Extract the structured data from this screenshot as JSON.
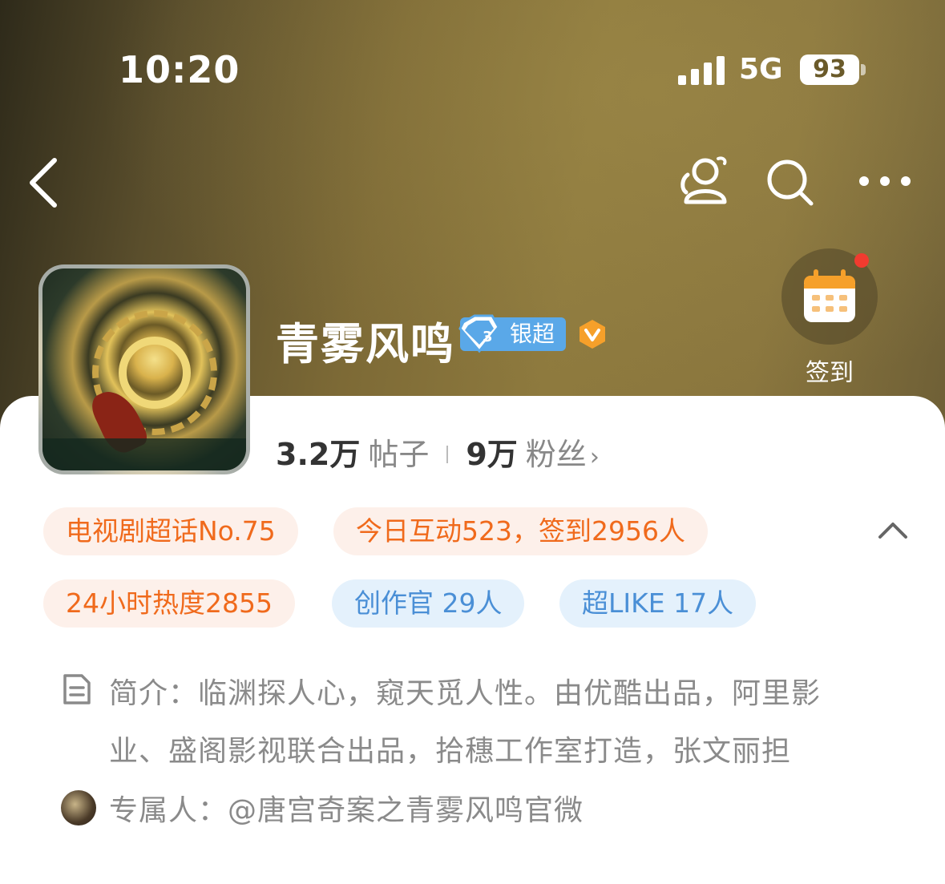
{
  "status_bar": {
    "time": "10:20",
    "network": "5G",
    "battery": "93"
  },
  "nav": {
    "icons": [
      "back-icon",
      "user-group-icon",
      "search-icon",
      "more-icon"
    ]
  },
  "topic": {
    "name": "青雾风鸣",
    "badge_label": "银超",
    "verified_icon": "v-badge-icon",
    "checkin_label": "签到",
    "posts_count": "3.2万",
    "posts_label": "帖子",
    "fans_count": "9万",
    "fans_label": "粉丝"
  },
  "tags": [
    {
      "label": "电视剧超话No.75",
      "color": "orange"
    },
    {
      "label": "今日互动523，签到2956人",
      "color": "orange"
    },
    {
      "label": "24小时热度2855",
      "color": "orange"
    },
    {
      "label": "创作官 29人",
      "color": "blue"
    },
    {
      "label": "超LIKE 17人",
      "color": "blue"
    }
  ],
  "intro": {
    "text": "简介：临渊探人心，窥天觅人性。由优酷出品，阿里影业、盛阁影视联合出品，拾穗工作室打造，张文丽担"
  },
  "owner": {
    "text": "专属人：@唐宫奇案之青雾风鸣官微"
  },
  "colors": {
    "accent_orange": "#f06a1c",
    "accent_blue": "#4a8fd6",
    "notification_red": "#f13b2f"
  }
}
